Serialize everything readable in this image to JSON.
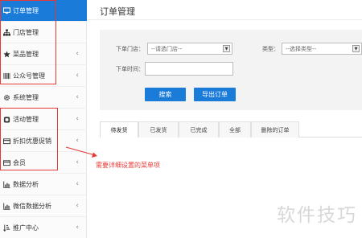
{
  "sidebar": {
    "items": [
      {
        "label": "订单管理",
        "icon": "monitor-icon",
        "active": true
      },
      {
        "label": "门店管理",
        "icon": "sitemap-icon"
      },
      {
        "label": "菜品管理",
        "icon": "star-icon",
        "chevron": "‹"
      },
      {
        "label": "公众号管理",
        "icon": "barcode-icon",
        "chevron": "‹"
      },
      {
        "label": "系统管理",
        "icon": "gear-icon",
        "chevron": "‹"
      },
      {
        "label": "活动管理",
        "icon": "github-icon",
        "chevron": "‹"
      },
      {
        "label": "折扣优惠促销",
        "icon": "card-icon",
        "chevron": "‹"
      },
      {
        "label": "会员",
        "icon": "card-icon",
        "chevron": "‹"
      },
      {
        "label": "数据分析",
        "icon": "bar-chart-icon",
        "chevron": "‹"
      },
      {
        "label": "微信数据分析",
        "icon": "bar-chart-icon",
        "chevron": "‹"
      },
      {
        "label": "推广中心",
        "icon": "sort-list-icon",
        "chevron": "‹"
      }
    ]
  },
  "main": {
    "title": "订单管理",
    "filters": {
      "store_label": "下单门店：",
      "store_placeholder": "--请选门店--",
      "type_label": "类型：",
      "type_placeholder": "--选择类型--",
      "time_label": "下单时间：",
      "search_button": "搜索",
      "export_button": "导出订单"
    },
    "tabs": [
      {
        "label": "待发货",
        "active": true
      },
      {
        "label": "已发货"
      },
      {
        "label": "已完成"
      },
      {
        "label": "全部"
      },
      {
        "label": "删除的订单"
      }
    ]
  },
  "annotation": {
    "text": "需要详细设置的菜单项",
    "color": "#e53935"
  },
  "watermark": "软件技巧",
  "colors": {
    "accent": "#1a7bd8",
    "annotation_red": "#e53935"
  }
}
